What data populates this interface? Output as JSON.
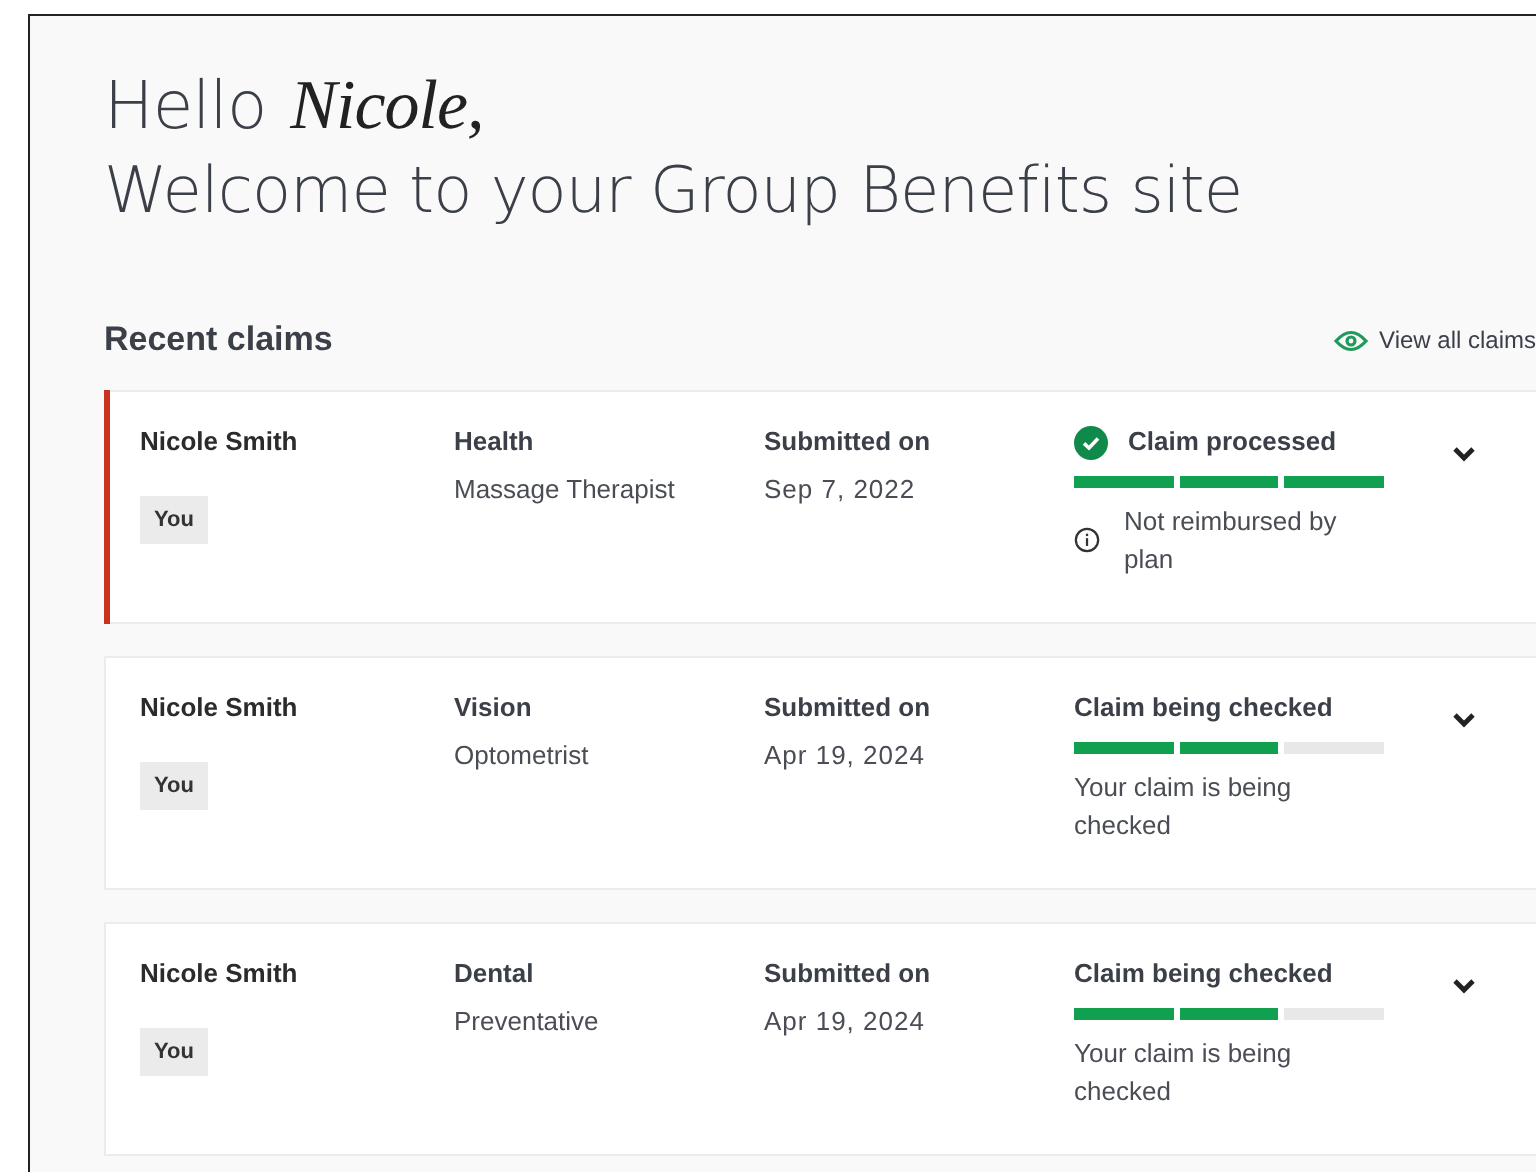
{
  "greeting": {
    "hello": "Hello",
    "name": "Nicole,",
    "welcome": "Welcome to your Group Benefits site"
  },
  "recent_claims": {
    "title": "Recent claims",
    "view_all": "View all claims"
  },
  "claims": [
    {
      "person": "Nicole Smith",
      "badge": "You",
      "category": "Health",
      "provider": "Massage Therapist",
      "date_label": "Submitted on",
      "date": "Sep 7, 2022",
      "kind": "processed",
      "status": "Claim processed",
      "steps": [
        {
          "done": true
        },
        {
          "done": true
        },
        {
          "done": true
        }
      ],
      "note": "Not reimbursed by plan",
      "highlighted": true,
      "expanded": false
    },
    {
      "person": "Nicole Smith",
      "badge": "You",
      "category": "Vision",
      "provider": "Optometrist",
      "date_label": "Submitted on",
      "date": "Apr 19, 2024",
      "kind": "checking",
      "status": "Claim being checked",
      "steps": [
        {
          "done": true
        },
        {
          "done": true
        },
        {
          "done": false
        }
      ],
      "note": "Your claim is being checked",
      "highlighted": false,
      "expanded": false
    },
    {
      "person": "Nicole Smith",
      "badge": "You",
      "category": "Dental",
      "provider": "Preventative",
      "date_label": "Submitted on",
      "date": "Apr 19, 2024",
      "kind": "checking",
      "status": "Claim being checked",
      "steps": [
        {
          "done": true
        },
        {
          "done": true
        },
        {
          "done": false
        }
      ],
      "note": "Your claim is being checked",
      "highlighted": false,
      "expanded": false
    }
  ]
}
